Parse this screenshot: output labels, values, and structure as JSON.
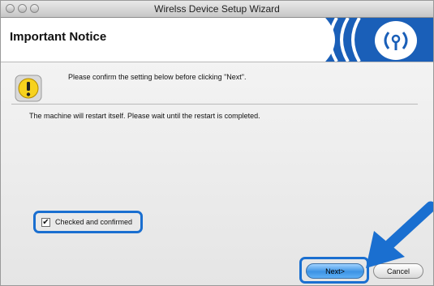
{
  "window": {
    "title": "Wirelss Device Setup Wizard"
  },
  "header": {
    "title": "Important Notice"
  },
  "notice": {
    "confirm_text": "Please confirm the setting below before clicking \"Next\".",
    "restart_text": "The machine will restart itself. Please wait until the restart is completed."
  },
  "checkbox": {
    "label": "Checked and confirmed",
    "checked": true
  },
  "buttons": {
    "next_label": "Next>",
    "cancel_label": "Cancel"
  },
  "colors": {
    "highlight": "#1a6fd0",
    "logo_blue": "#1a5fb8",
    "next_button": "#3d93e4"
  }
}
